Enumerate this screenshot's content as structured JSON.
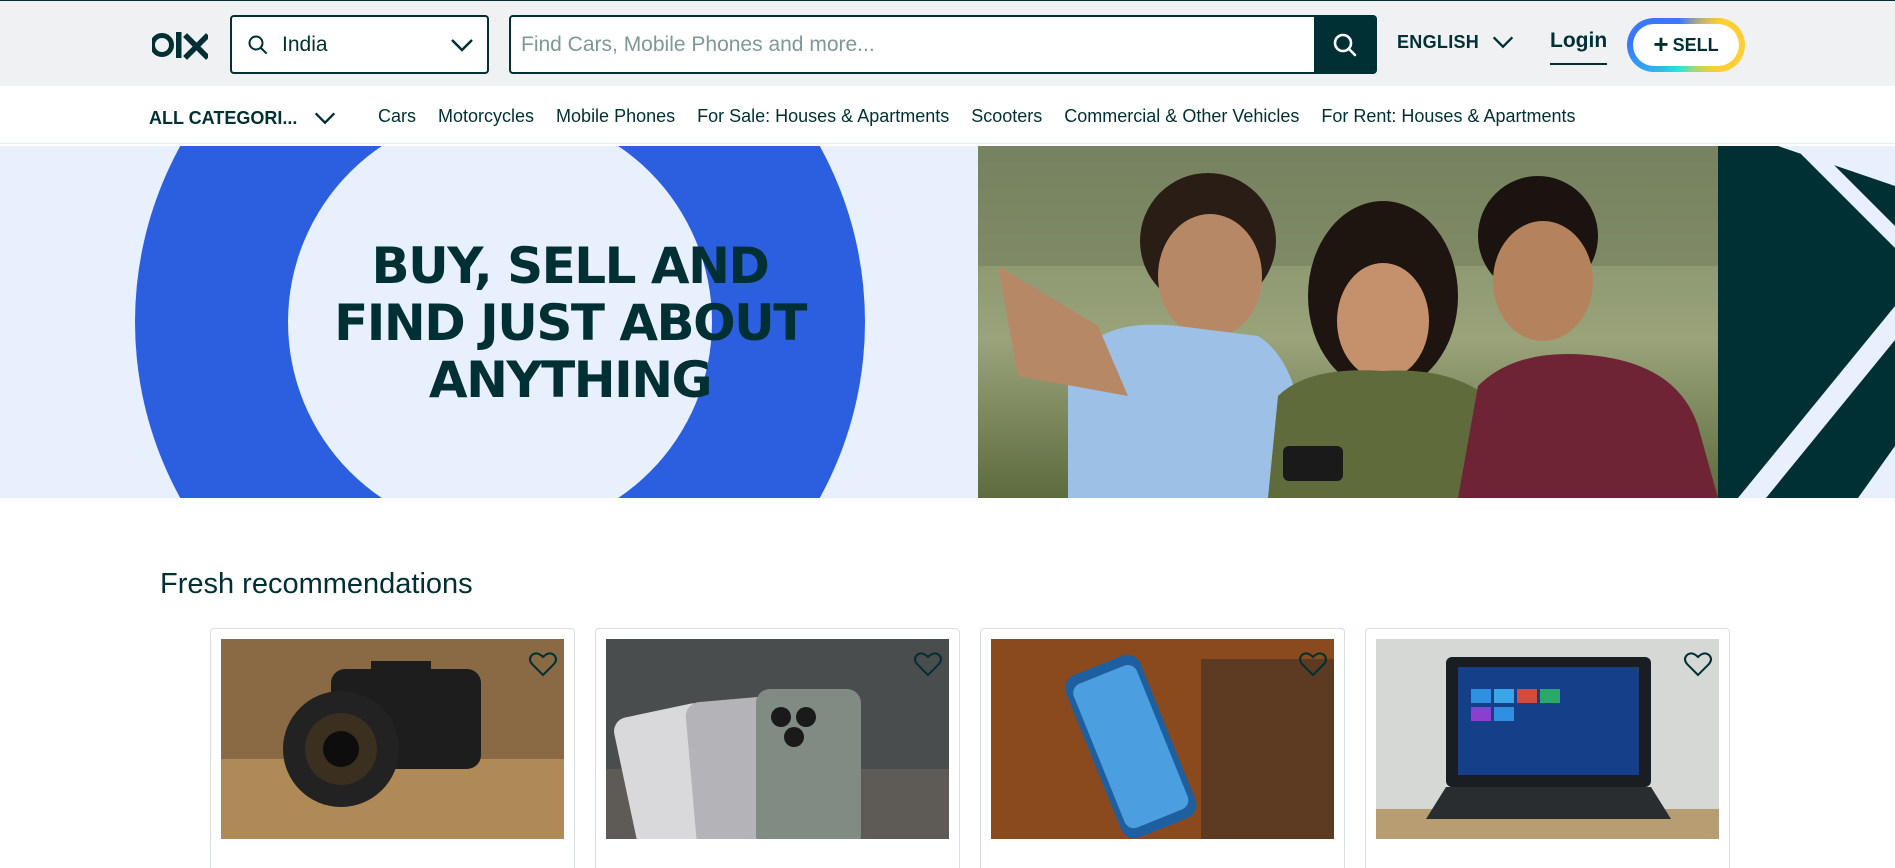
{
  "colors": {
    "primary": "#002f34",
    "accent_blue": "#3a77ff",
    "header_bg": "#eff1f3",
    "banner_light": "#e8f0fd"
  },
  "header": {
    "logo_text": "olx",
    "location": {
      "value": "India",
      "icon": "search-icon"
    },
    "search": {
      "placeholder": "Find Cars, Mobile Phones and more...",
      "value": ""
    },
    "language_label": "ENGLISH",
    "login_label": "Login",
    "sell_label": "SELL"
  },
  "categories": {
    "all_label": "ALL CATEGORI...",
    "links": [
      "Cars",
      "Motorcycles",
      "Mobile Phones",
      "For Sale: Houses & Apartments",
      "Scooters",
      "Commercial & Other Vehicles",
      "For Rent: Houses & Apartments"
    ]
  },
  "banner": {
    "line1": "BUY, SELL AND",
    "line2": "FIND JUST ABOUT",
    "line3": "ANYTHING"
  },
  "recommendations": {
    "title": "Fresh recommendations",
    "items": [
      {
        "image": "camera-photo",
        "icon": "heart-icon"
      },
      {
        "image": "iphones-photo",
        "icon": "heart-icon"
      },
      {
        "image": "smartphone-photo",
        "icon": "heart-icon"
      },
      {
        "image": "laptop-photo",
        "icon": "heart-icon"
      }
    ]
  }
}
